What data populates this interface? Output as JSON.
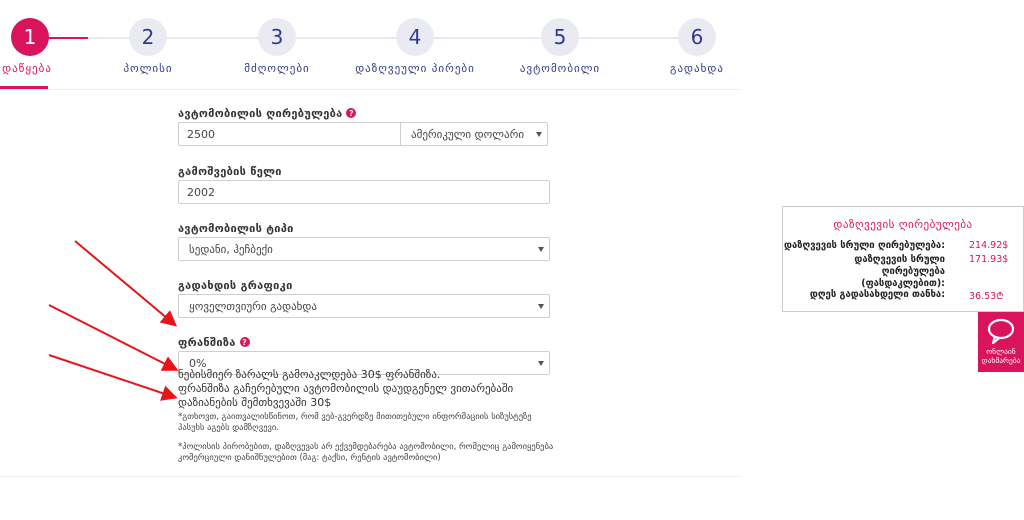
{
  "stepper": {
    "steps": [
      {
        "number": "1",
        "label": "დაწყება"
      },
      {
        "number": "2",
        "label": "პოლისი"
      },
      {
        "number": "3",
        "label": "მძღოლები"
      },
      {
        "number": "4",
        "label": "დაზღვეული პირები"
      },
      {
        "number": "5",
        "label": "ავტომობილი"
      },
      {
        "number": "6",
        "label": "გადახდა"
      }
    ],
    "active_step": 1
  },
  "form": {
    "car_value": {
      "label": "ავტომობილის ღირებულება",
      "value": "2500",
      "currency": "ამერიკული დოლარი"
    },
    "year": {
      "label": "გამოშვების წელი",
      "value": "2002"
    },
    "car_type": {
      "label": "ავტომობილის ტიპი",
      "value": "სედანი, ჰეჩბექი"
    },
    "schedule": {
      "label": "გადახდის გრაფიკი",
      "value": "ყოველთვიური გადახდა"
    },
    "franchise": {
      "label": "ფრანშიზა",
      "value": "0%"
    }
  },
  "notes": {
    "line1": "ნებისმიერ ზარალს გამოაკლდება 30$ ფრანშიზა.",
    "line2": "ფრანშიზა გაჩერებული ავტომობილის დაუდგენელ ვითარებაში დაზიანების შემთხვევაში 30$",
    "small1": "*გთხოვთ, გაითვალისწინოთ, რომ ვებ-გვერდზე მითითებული ინფორმაციის სიზუსტეზე პასუხს აგებს დამზღვევი.",
    "small2": "*პოლისის პირობებით, დაზღვევას არ ექვემდებარება ავტომობილი, რომელიც გამოიყენება კომერციული დანიშნულებით (მაგ: ტაქსი, რენტის ავტომობილი)"
  },
  "summary": {
    "title": "დაზღვევის ღირებულება",
    "rows": [
      {
        "key": "დაზღვევის სრული ღირებულება:",
        "value": "214.92$"
      },
      {
        "key": "დაზღვევის სრული ღირებულება (ფასდაკლებით):",
        "value": "171.93$"
      },
      {
        "key": "დღეს გადასახდელი თანხა:",
        "value": "36.53₾"
      }
    ]
  },
  "chat": {
    "label": "ონლაინ დახმარება",
    "icon": "chat-bubble-icon"
  },
  "colors": {
    "accent": "#d9145c",
    "step_text": "#2e3a8c",
    "arrow": "#e8141c"
  }
}
